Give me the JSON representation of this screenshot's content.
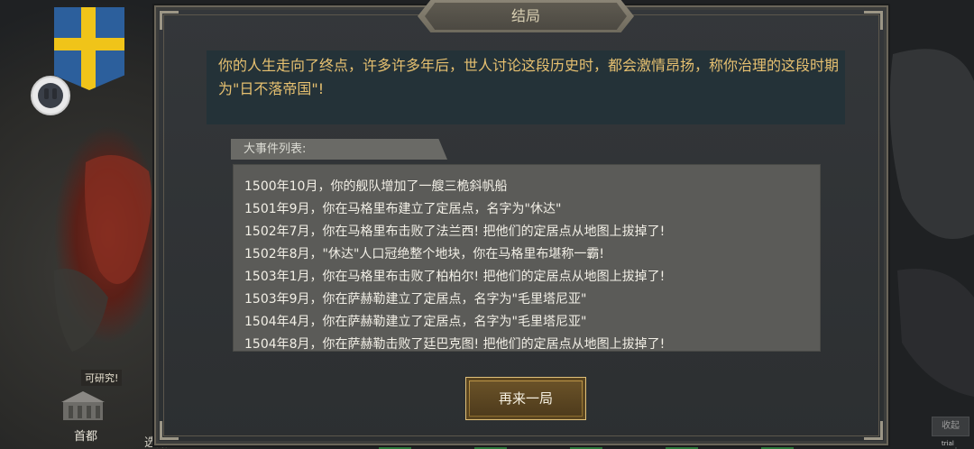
{
  "dialog": {
    "title": "结局",
    "summary": "你的人生走向了终点，许多许多年后，世人讨论这段历史时，都会激情昂扬，称你治理的这段时期为\"日不落帝国\"!",
    "events_header": "大事件列表:",
    "events": [
      "1500年10月，你的舰队增加了一艘三桅斜帆船",
      "1501年9月，你在马格里布建立了定居点，名字为\"休达\"",
      "1502年7月，你在马格里布击败了法兰西! 把他们的定居点从地图上拔掉了!",
      "1502年8月，\"休达\"人口冠绝整个地块，你在马格里布堪称一霸!",
      "1503年1月，你在马格里布击败了柏柏尔! 把他们的定居点从地图上拔掉了!",
      "1503年9月，你在萨赫勒建立了定居点，名字为\"毛里塔尼亚\"",
      "1504年4月，你在萨赫勒建立了定居点，名字为\"毛里塔尼亚\"",
      "1504年8月，你在萨赫勒击败了廷巴克图! 把他们的定居点从地图上拔掉了!"
    ],
    "restart_label": "再来一局"
  },
  "background": {
    "research_tag": "可研究!",
    "capital_label": "首都",
    "partial_label": "选船",
    "collapse_label": "收起",
    "trial_label": "trial version",
    "flag_icon": "swedish-flag-icon"
  },
  "colors": {
    "summary_text": "#e6c070",
    "summary_bg": "#243238",
    "event_text": "#f2efe6",
    "button_gold": "#c29a4a"
  }
}
